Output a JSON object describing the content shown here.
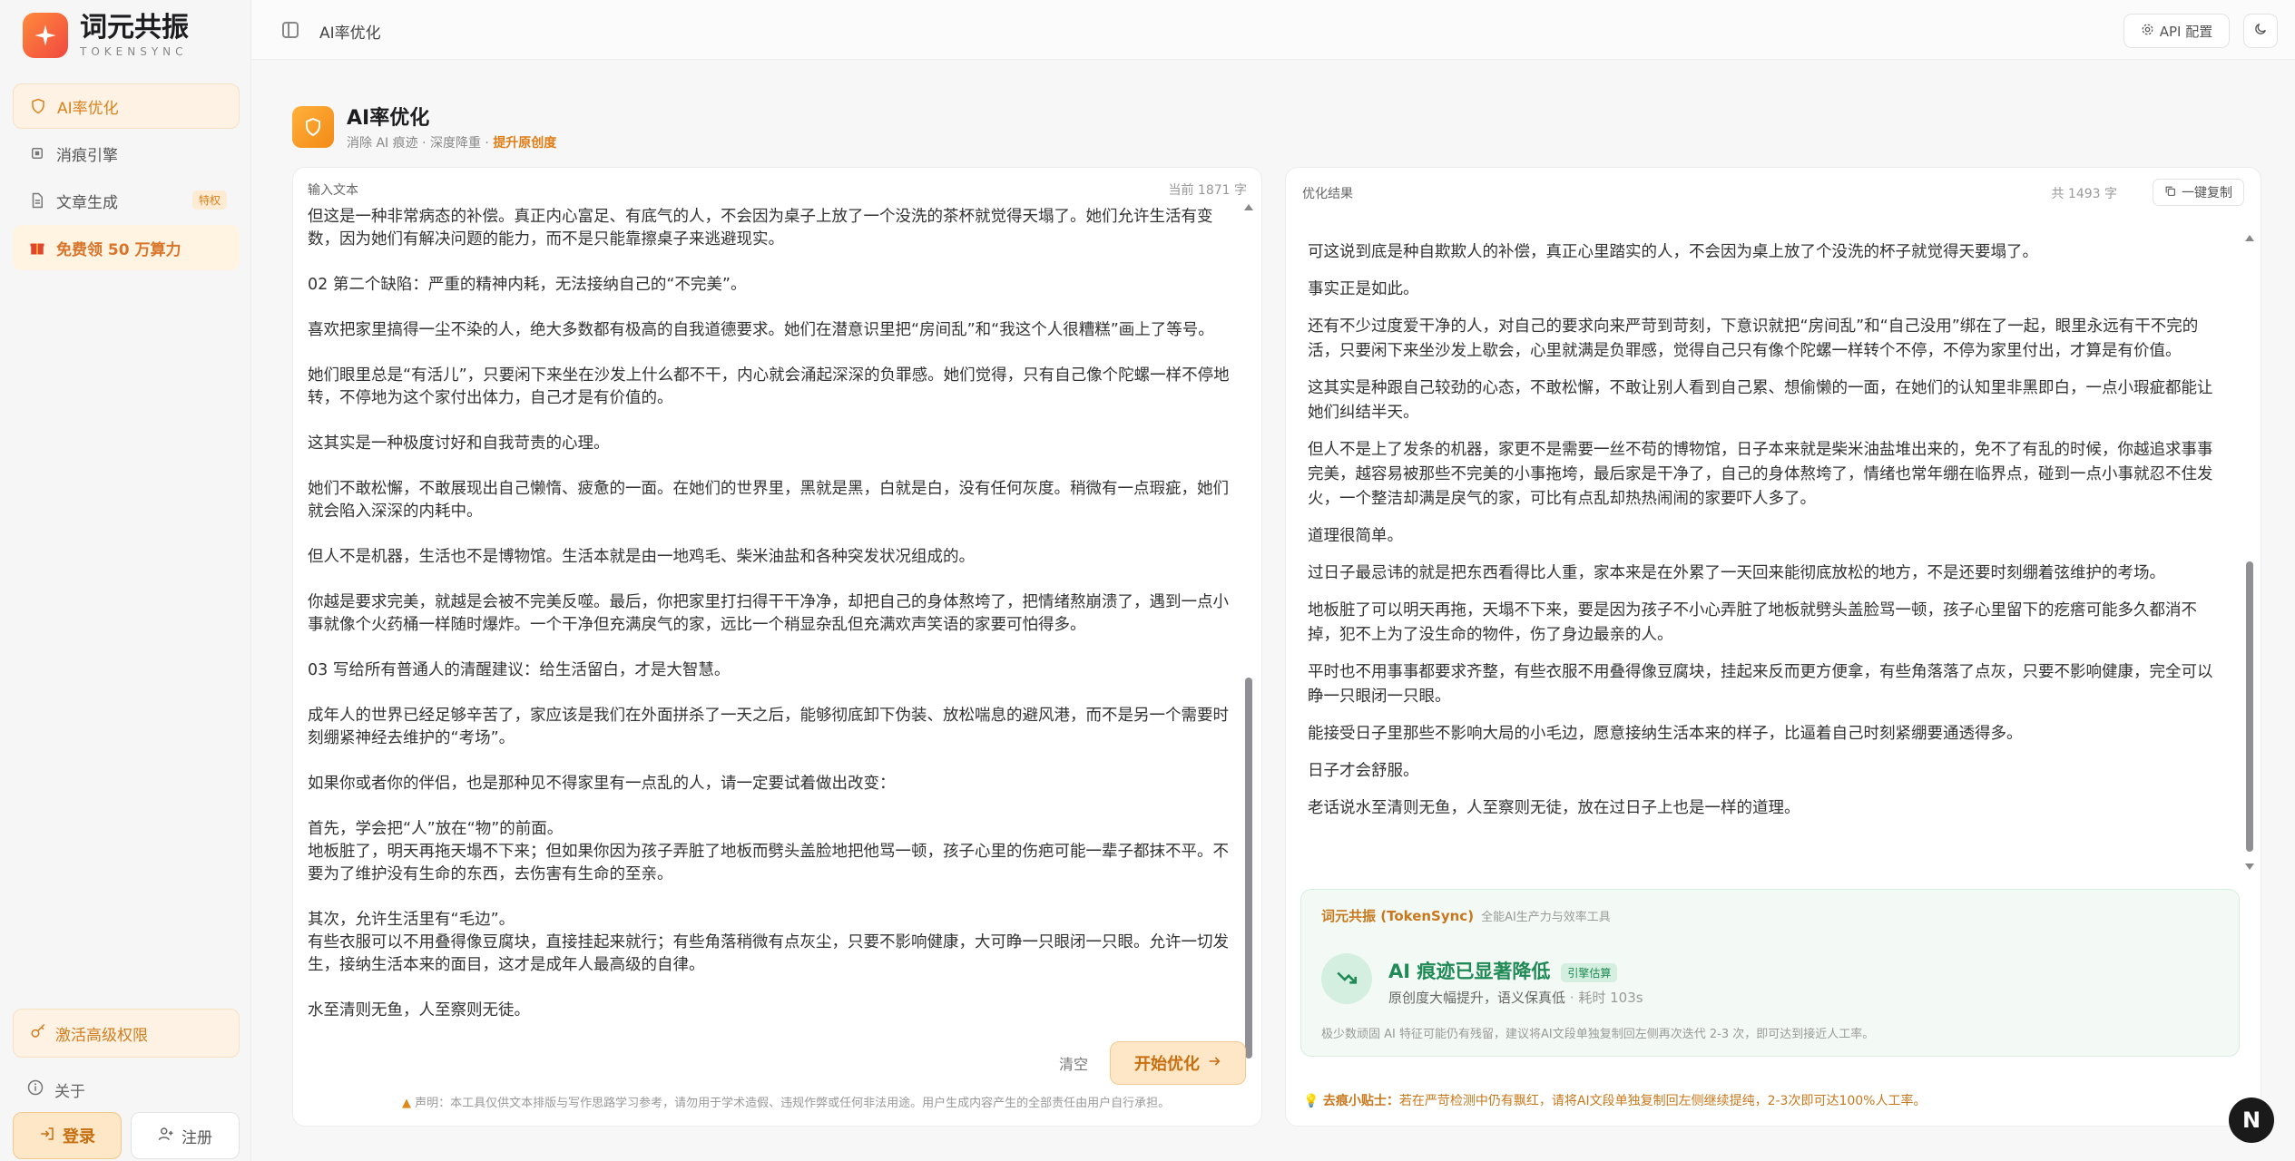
{
  "brand": {
    "title": "词元共振",
    "subtitle": "TOKENSYNC"
  },
  "sidebar": {
    "items": [
      {
        "label": "AI率优化",
        "icon": "shield-icon",
        "active": true
      },
      {
        "label": "消痕引擎",
        "icon": "chip-icon"
      },
      {
        "label": "文章生成",
        "icon": "document-icon",
        "tag": "特权"
      },
      {
        "label": "免费领 50 万算力",
        "icon": "gift-icon",
        "promo": true
      }
    ],
    "activate_label": "激活高级权限",
    "about_label": "关于",
    "login_label": "登录",
    "register_label": "注册"
  },
  "header": {
    "breadcrumb": "AI率优化",
    "api_label": "API 配置"
  },
  "page": {
    "title": "AI率优化",
    "subtitle_prefix": "消除 AI 痕迹 · 深度降重 · ",
    "subtitle_highlight": "提升原创度"
  },
  "input": {
    "label": "输入文本",
    "count": "当前 1871 字",
    "paragraphs": [
      "但这是一种非常病态的补偿。真正内心富足、有底气的人，不会因为桌子上放了一个没洗的茶杯就觉得天塌了。她们允许生活有变数，因为她们有解决问题的能力，而不是只能靠擦桌子来逃避现实。",
      "02 第二个缺陷：严重的精神内耗，无法接纳自己的“不完美”。",
      "喜欢把家里搞得一尘不染的人，绝大多数都有极高的自我道德要求。她们在潜意识里把“房间乱”和“我这个人很糟糕”画上了等号。",
      "她们眼里总是“有活儿”，只要闲下来坐在沙发上什么都不干，内心就会涌起深深的负罪感。她们觉得，只有自己像个陀螺一样不停地转，不停地为这个家付出体力，自己才是有价值的。",
      "这其实是一种极度讨好和自我苛责的心理。",
      "她们不敢松懈，不敢展现出自己懒惰、疲惫的一面。在她们的世界里，黑就是黑，白就是白，没有任何灰度。稍微有一点瑕疵，她们就会陷入深深的内耗中。",
      "但人不是机器，生活也不是博物馆。生活本就是由一地鸡毛、柴米油盐和各种突发状况组成的。",
      "你越是要求完美，就越是会被不完美反噬。最后，你把家里打扫得干干净净，却把自己的身体熬垮了，把情绪熬崩溃了，遇到一点小事就像个火药桶一样随时爆炸。一个干净但充满戾气的家，远比一个稍显杂乱但充满欢声笑语的家要可怕得多。",
      "03 写给所有普通人的清醒建议：给生活留白，才是大智慧。",
      "成年人的世界已经足够辛苦了，家应该是我们在外面拼杀了一天之后，能够彻底卸下伪装、放松喘息的避风港，而不是另一个需要时刻绷紧神经去维护的“考场”。",
      "如果你或者你的伴侣，也是那种见不得家里有一点乱的人，请一定要试着做出改变：",
      "首先，学会把“人”放在“物”的前面。",
      "地板脏了，明天再拖天塌不下来；但如果你因为孩子弄脏了地板而劈头盖脸地把他骂一顿，孩子心里的伤疤可能一辈子都抹不平。不要为了维护没有生命的东西，去伤害有生命的至亲。",
      "其次，允许生活里有“毛边”。",
      "有些衣服可以不用叠得像豆腐块，直接挂起来就行；有些角落稍微有点灰尘，只要不影响健康，大可睁一只眼闭一只眼。允许一切发生，接纳生活本来的面目，这才是成年人最高级的自律。",
      "水至清则无鱼，人至察则无徒。"
    ],
    "clear_label": "清空",
    "start_label": "开始优化",
    "disclaimer": "声明：本工具仅供文本排版与写作思路学习参考，请勿用于学术造假、违规作弊或任何非法用途。用户生成内容产生的全部责任由用户自行承担。"
  },
  "result": {
    "label": "优化结果",
    "count": "共 1493 字",
    "copy_label": "一键复制",
    "paragraphs": [
      "可这说到底是种自欺欺人的补偿，真正心里踏实的人，不会因为桌上放了个没洗的杯子就觉得天要塌了。",
      "事实正是如此。",
      "还有不少过度爱干净的人，对自己的要求向来严苛到苛刻，下意识就把“房间乱”和“自己没用”绑在了一起，眼里永远有干不完的活，只要闲下来坐沙发上歇会，心里就满是负罪感，觉得自己只有像个陀螺一样转个不停，不停为家里付出，才算是有价值。",
      "这其实是种跟自己较劲的心态，不敢松懈，不敢让别人看到自己累、想偷懒的一面，在她们的认知里非黑即白，一点小瑕疵都能让她们纠结半天。",
      "但人不是上了发条的机器，家更不是需要一丝不苟的博物馆，日子本来就是柴米油盐堆出来的，免不了有乱的时候，你越追求事事完美，越容易被那些不完美的小事拖垮，最后家是干净了，自己的身体熬垮了，情绪也常年绷在临界点，碰到一点小事就忍不住发火，一个整洁却满是戾气的家，可比有点乱却热热闹闹的家要吓人多了。",
      "道理很简单。",
      "过日子最忌讳的就是把东西看得比人重，家本来是在外累了一天回来能彻底放松的地方，不是还要时刻绷着弦维护的考场。",
      "地板脏了可以明天再拖，天塌不下来，要是因为孩子不小心弄脏了地板就劈头盖脸骂一顿，孩子心里留下的疙瘩可能多久都消不掉，犯不上为了没生命的物件，伤了身边最亲的人。",
      "平时也不用事事都要求齐整，有些衣服不用叠得像豆腐块，挂起来反而更方便拿，有些角落落了点灰，只要不影响健康，完全可以睁一只眼闭一只眼。",
      "能接受日子里那些不影响大局的小毛边，愿意接纳生活本来的样子，比逼着自己时刻紧绷要通透得多。",
      "日子才会舒服。",
      "老话说水至清则无鱼，人至察则无徒，放在过日子上也是一样的道理。"
    ]
  },
  "status": {
    "brand": "词元共振 (TokenSync)",
    "brand_sub": "全能AI生产力与效率工具",
    "title": "AI 痕迹已显著降低",
    "badge": "引擎估算",
    "sub": "原创度大幅提升，语义保真低",
    "elapsed": "· 耗时 103s",
    "note": "极少数顽固 AI 特征可能仍有残留，建议将AI文段单独复制回左侧再次迭代 2-3 次，即可达到接近人工率。"
  },
  "tip": {
    "prefix": "去痕小贴士：",
    "text": "若在严苛检测中仍有飘红，请将AI文段单独复制回左侧继续提纯，2-3次即可达100%人工率。"
  },
  "floating": {
    "label": "N"
  },
  "colors": {
    "accent": "#e07d14",
    "success": "#1f8a55"
  }
}
